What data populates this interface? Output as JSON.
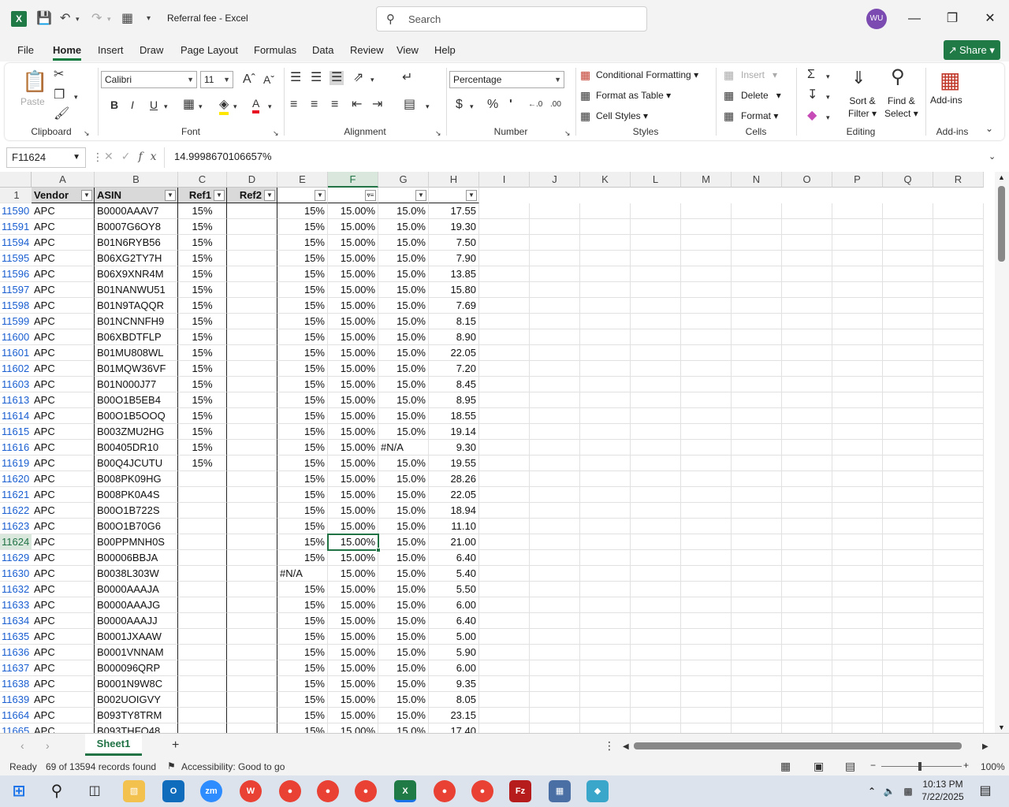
{
  "app": {
    "title": "Referral fee  -  Excel",
    "search_placeholder": "Search",
    "user_initials": "WU",
    "share_label": "Share"
  },
  "menu": [
    "File",
    "Home",
    "Insert",
    "Draw",
    "Page Layout",
    "Formulas",
    "Data",
    "Review",
    "View",
    "Help"
  ],
  "ribbon": {
    "clipboard": {
      "label": "Clipboard",
      "paste": "Paste"
    },
    "font": {
      "label": "Font",
      "name": "Calibri",
      "size": "11"
    },
    "alignment": {
      "label": "Alignment"
    },
    "number": {
      "label": "Number",
      "format": "Percentage"
    },
    "styles": {
      "label": "Styles",
      "conditional": "Conditional Formatting",
      "format_table": "Format as Table",
      "cell_styles": "Cell Styles"
    },
    "cells": {
      "label": "Cells",
      "insert": "Insert",
      "delete": "Delete",
      "format": "Format"
    },
    "editing": {
      "label": "Editing",
      "sort_filter": "Sort &",
      "sort_filter2": "Filter",
      "find_select": "Find &",
      "find_select2": "Select"
    },
    "addins": {
      "label": "Add-ins",
      "button": "Add-ins"
    }
  },
  "formula": {
    "namebox": "F11624",
    "content": "14.9998670106657%"
  },
  "columns": [
    "A",
    "B",
    "C",
    "D",
    "E",
    "F",
    "G",
    "H",
    "I",
    "J",
    "K",
    "L",
    "M",
    "N",
    "O",
    "P",
    "Q",
    "R"
  ],
  "header_row": {
    "num": "1",
    "cells": [
      "Vendor",
      "ASIN",
      "Ref1",
      "Ref2",
      "",
      "",
      "",
      ""
    ]
  },
  "rows": [
    {
      "n": "11590",
      "a": "APC",
      "b": "B0000AAAV7",
      "c": "15%",
      "e": "15%",
      "f": "15.00%",
      "g": "15.0%",
      "h": "17.55"
    },
    {
      "n": "11591",
      "a": "APC",
      "b": "B0007G6OY8",
      "c": "15%",
      "e": "15%",
      "f": "15.00%",
      "g": "15.0%",
      "h": "19.30"
    },
    {
      "n": "11594",
      "a": "APC",
      "b": "B01N6RYB56",
      "c": "15%",
      "e": "15%",
      "f": "15.00%",
      "g": "15.0%",
      "h": "7.50"
    },
    {
      "n": "11595",
      "a": "APC",
      "b": "B06XG2TY7H",
      "c": "15%",
      "e": "15%",
      "f": "15.00%",
      "g": "15.0%",
      "h": "7.90"
    },
    {
      "n": "11596",
      "a": "APC",
      "b": "B06X9XNR4M",
      "c": "15%",
      "e": "15%",
      "f": "15.00%",
      "g": "15.0%",
      "h": "13.85"
    },
    {
      "n": "11597",
      "a": "APC",
      "b": "B01NANWU51",
      "c": "15%",
      "e": "15%",
      "f": "15.00%",
      "g": "15.0%",
      "h": "15.80"
    },
    {
      "n": "11598",
      "a": "APC",
      "b": "B01N9TAQQR",
      "c": "15%",
      "e": "15%",
      "f": "15.00%",
      "g": "15.0%",
      "h": "7.69"
    },
    {
      "n": "11599",
      "a": "APC",
      "b": "B01NCNNFH9",
      "c": "15%",
      "e": "15%",
      "f": "15.00%",
      "g": "15.0%",
      "h": "8.15"
    },
    {
      "n": "11600",
      "a": "APC",
      "b": "B06XBDTFLP",
      "c": "15%",
      "e": "15%",
      "f": "15.00%",
      "g": "15.0%",
      "h": "8.90"
    },
    {
      "n": "11601",
      "a": "APC",
      "b": "B01MU808WL",
      "c": "15%",
      "e": "15%",
      "f": "15.00%",
      "g": "15.0%",
      "h": "22.05"
    },
    {
      "n": "11602",
      "a": "APC",
      "b": "B01MQW36VF",
      "c": "15%",
      "e": "15%",
      "f": "15.00%",
      "g": "15.0%",
      "h": "7.20"
    },
    {
      "n": "11603",
      "a": "APC",
      "b": "B01N000J77",
      "c": "15%",
      "e": "15%",
      "f": "15.00%",
      "g": "15.0%",
      "h": "8.45"
    },
    {
      "n": "11613",
      "a": "APC",
      "b": "B00O1B5EB4",
      "c": "15%",
      "e": "15%",
      "f": "15.00%",
      "g": "15.0%",
      "h": "8.95"
    },
    {
      "n": "11614",
      "a": "APC",
      "b": "B00O1B5OOQ",
      "c": "15%",
      "e": "15%",
      "f": "15.00%",
      "g": "15.0%",
      "h": "18.55"
    },
    {
      "n": "11615",
      "a": "APC",
      "b": "B003ZMU2HG",
      "c": "15%",
      "e": "15%",
      "f": "15.00%",
      "g": "15.0%",
      "h": "19.14"
    },
    {
      "n": "11616",
      "a": "APC",
      "b": "B00405DR10",
      "c": "15%",
      "e": "15%",
      "f": "15.00%",
      "g": "#N/A",
      "h": "9.30"
    },
    {
      "n": "11619",
      "a": "APC",
      "b": "B00Q4JCUTU",
      "c": "15%",
      "e": "15%",
      "f": "15.00%",
      "g": "15.0%",
      "h": "19.55"
    },
    {
      "n": "11620",
      "a": "APC",
      "b": "B008PK09HG",
      "c": "",
      "e": "15%",
      "f": "15.00%",
      "g": "15.0%",
      "h": "28.26"
    },
    {
      "n": "11621",
      "a": "APC",
      "b": "B008PK0A4S",
      "c": "",
      "e": "15%",
      "f": "15.00%",
      "g": "15.0%",
      "h": "22.05"
    },
    {
      "n": "11622",
      "a": "APC",
      "b": "B00O1B722S",
      "c": "",
      "e": "15%",
      "f": "15.00%",
      "g": "15.0%",
      "h": "18.94"
    },
    {
      "n": "11623",
      "a": "APC",
      "b": "B00O1B70G6",
      "c": "",
      "e": "15%",
      "f": "15.00%",
      "g": "15.0%",
      "h": "11.10"
    },
    {
      "n": "11624",
      "a": "APC",
      "b": "B00PPMNH0S",
      "c": "",
      "e": "15%",
      "f": "15.00%",
      "g": "15.0%",
      "h": "21.00"
    },
    {
      "n": "11629",
      "a": "APC",
      "b": "B00006BBJA",
      "c": "",
      "e": "15%",
      "f": "15.00%",
      "g": "15.0%",
      "h": "6.40"
    },
    {
      "n": "11630",
      "a": "APC",
      "b": "B0038L303W",
      "c": "",
      "e": "#N/A",
      "f": "15.00%",
      "g": "15.0%",
      "h": "5.40"
    },
    {
      "n": "11632",
      "a": "APC",
      "b": "B0000AAAJA",
      "c": "",
      "e": "15%",
      "f": "15.00%",
      "g": "15.0%",
      "h": "5.50"
    },
    {
      "n": "11633",
      "a": "APC",
      "b": "B0000AAAJG",
      "c": "",
      "e": "15%",
      "f": "15.00%",
      "g": "15.0%",
      "h": "6.00"
    },
    {
      "n": "11634",
      "a": "APC",
      "b": "B0000AAAJJ",
      "c": "",
      "e": "15%",
      "f": "15.00%",
      "g": "15.0%",
      "h": "6.40"
    },
    {
      "n": "11635",
      "a": "APC",
      "b": "B0001JXAAW",
      "c": "",
      "e": "15%",
      "f": "15.00%",
      "g": "15.0%",
      "h": "5.00"
    },
    {
      "n": "11636",
      "a": "APC",
      "b": "B0001VNNAM",
      "c": "",
      "e": "15%",
      "f": "15.00%",
      "g": "15.0%",
      "h": "5.90"
    },
    {
      "n": "11637",
      "a": "APC",
      "b": "B000096QRP",
      "c": "",
      "e": "15%",
      "f": "15.00%",
      "g": "15.0%",
      "h": "6.00"
    },
    {
      "n": "11638",
      "a": "APC",
      "b": "B0001N9W8C",
      "c": "",
      "e": "15%",
      "f": "15.00%",
      "g": "15.0%",
      "h": "9.35"
    },
    {
      "n": "11639",
      "a": "APC",
      "b": "B002UOIGVY",
      "c": "",
      "e": "15%",
      "f": "15.00%",
      "g": "15.0%",
      "h": "8.05"
    },
    {
      "n": "11664",
      "a": "APC",
      "b": "B093TY8TRM",
      "c": "",
      "e": "15%",
      "f": "15.00%",
      "g": "15.0%",
      "h": "23.15"
    },
    {
      "n": "11665",
      "a": "APC",
      "b": "B093THFQ48",
      "c": "",
      "e": "15%",
      "f": "15.00%",
      "g": "15.0%",
      "h": "17.40"
    }
  ],
  "active_row": "11624",
  "sheet": {
    "name": "Sheet1"
  },
  "status": {
    "ready": "Ready",
    "records": "69 of 13594 records found",
    "accessibility": "Accessibility: Good to go",
    "zoom": "100%"
  },
  "taskbar": {
    "time": "10:13 PM",
    "date": "7/22/2025"
  },
  "colors": {
    "excel_green": "#217346",
    "share_green": "#1f7a45",
    "row_number_blue": "#1a5fd1"
  }
}
